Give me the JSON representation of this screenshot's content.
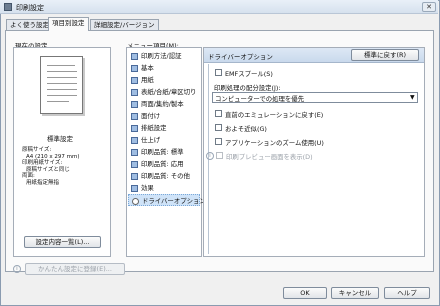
{
  "window": {
    "title": "印刷設定",
    "close_glyph": "✕"
  },
  "tabs": [
    {
      "label": "よく使う設定",
      "active": false
    },
    {
      "label": "項目別設定",
      "active": true
    },
    {
      "label": "詳細設定/バージョン",
      "active": false
    }
  ],
  "current_settings": {
    "heading": "現在の設定",
    "name": "標準設定",
    "summary": [
      "原稿サイズ:",
      "A4 (210 x 297 mm)",
      "印刷用紙サイズ:",
      "原稿サイズと同じ",
      "両面:",
      "用紙指定無指"
    ],
    "list_button": "設定内容一覧(L)..."
  },
  "easy_setup_button": "かんたん設定に登録(E)...",
  "menu": {
    "heading": "メニュー項目(M):",
    "items": [
      "印刷方法/認証",
      "基本",
      "用紙",
      "表紙/合紙/章区切り",
      "両面/集約/製本",
      "面付け",
      "排紙設定",
      "仕上げ",
      "印刷品質: 標準",
      "印刷品質: 応用",
      "印刷品質: その他",
      "効果",
      "ドライバーオプション"
    ],
    "selected_index": 12
  },
  "options": {
    "title": "ドライバーオプション",
    "restore_button": "標準に戻す(R)",
    "emf_spool": {
      "label": "EMFスプール(S)",
      "checked": false
    },
    "priority_label": "印刷処理の配分設定(J):",
    "priority_value": "コンピューターでの処理を優先",
    "restore_emulation": {
      "label": "直前のエミュレーションに戻す(E)",
      "checked": false
    },
    "approx_shape": {
      "label": "およそ近似(G)",
      "checked": false
    },
    "app_zoom": {
      "label": "アプリケーションのズーム使用(U)",
      "checked": false
    },
    "print_preview": {
      "label": "印刷プレビュー画面を表示(D)",
      "checked": false,
      "disabled": true
    }
  },
  "footer": {
    "ok": "OK",
    "cancel": "キャンセル",
    "help": "ヘルプ"
  }
}
